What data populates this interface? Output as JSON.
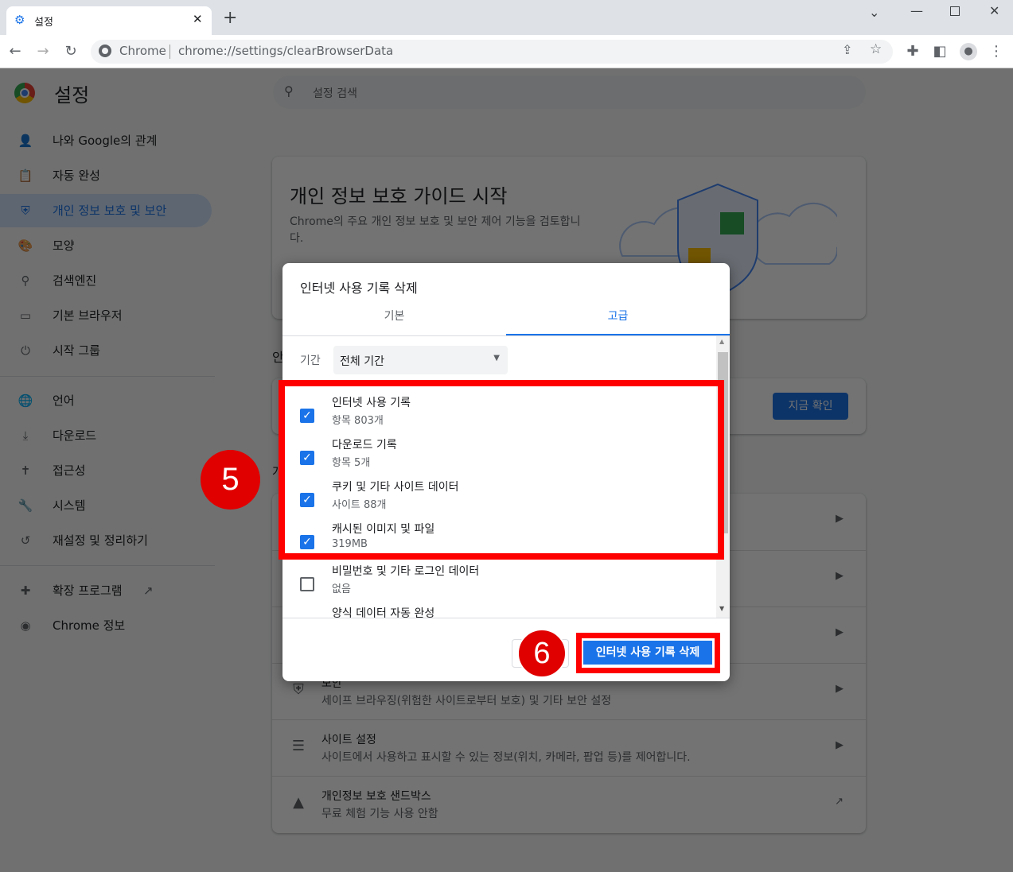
{
  "browser": {
    "tab_title": "설정",
    "omnibox_site": "Chrome",
    "url": "chrome://settings/clearBrowserData"
  },
  "header": {
    "title": "설정",
    "search_placeholder": "설정 검색"
  },
  "sidebar": {
    "items": [
      {
        "label": "나와 Google의 관계",
        "icon": "person-icon"
      },
      {
        "label": "자동 완성",
        "icon": "clipboard-icon"
      },
      {
        "label": "개인 정보 보호 및 보안",
        "icon": "shield-icon",
        "selected": true
      },
      {
        "label": "모양",
        "icon": "palette-icon"
      },
      {
        "label": "검색엔진",
        "icon": "search-icon"
      },
      {
        "label": "기본 브라우저",
        "icon": "browser-icon"
      },
      {
        "label": "시작 그룹",
        "icon": "power-icon"
      },
      {
        "label": "언어",
        "icon": "globe-icon"
      },
      {
        "label": "다운로드",
        "icon": "download-icon"
      },
      {
        "label": "접근성",
        "icon": "accessibility-icon"
      },
      {
        "label": "시스템",
        "icon": "wrench-icon"
      },
      {
        "label": "재설정 및 정리하기",
        "icon": "history-icon"
      },
      {
        "label": "확장 프로그램",
        "icon": "puzzle-icon"
      },
      {
        "label": "Chrome 정보",
        "icon": "chrome-icon"
      }
    ]
  },
  "main": {
    "guide": {
      "title": "개인 정보 보호 가이드 시작",
      "desc": "Chrome의 주요 개인 정보 보호 및 보안 제어 기능을 검토합니다."
    },
    "safety_label": "안",
    "safety_button": "지금 확인",
    "section_label": "개",
    "rows": [
      {
        "title": "",
        "desc": ""
      },
      {
        "title": "",
        "desc": ""
      },
      {
        "title": "",
        "desc": ""
      },
      {
        "title": "보안",
        "desc": "세이프 브라우징(위험한 사이트로부터 보호) 및 기타 보안 설정",
        "icon": "shield-icon"
      },
      {
        "title": "사이트 설정",
        "desc": "사이트에서 사용하고 표시할 수 있는 정보(위치, 카메라, 팝업 등)를 제어합니다.",
        "icon": "sliders-icon"
      },
      {
        "title": "개인정보 보호 샌드박스",
        "desc": "무료 체험 기능 사용 안함",
        "icon": "flask-icon"
      }
    ]
  },
  "dialog": {
    "title": "인터넷 사용 기록 삭제",
    "tabs": [
      "기본",
      "고급"
    ],
    "active_tab": "고급",
    "period_label": "기간",
    "period_value": "전체 기간",
    "items": [
      {
        "title": "인터넷 사용 기록",
        "desc": "항목 803개",
        "checked": true
      },
      {
        "title": "다운로드 기록",
        "desc": "항목 5개",
        "checked": true
      },
      {
        "title": "쿠키 및 기타 사이트 데이터",
        "desc": "사이트 88개",
        "checked": true
      },
      {
        "title": "캐시된 이미지 및 파일",
        "desc": "319MB",
        "checked": true
      },
      {
        "title": "비밀번호 및 기타 로그인 데이터",
        "desc": "없음",
        "checked": false
      },
      {
        "title": "양식 데이터 자동 완성",
        "desc": "",
        "checked": false
      }
    ],
    "confirm_button": "인터넷 사용 기록 삭제"
  },
  "annotations": {
    "step5": "5",
    "step6": "6",
    "highlight_color": "#ff0000"
  },
  "colors": {
    "accent": "#1a73e8"
  }
}
